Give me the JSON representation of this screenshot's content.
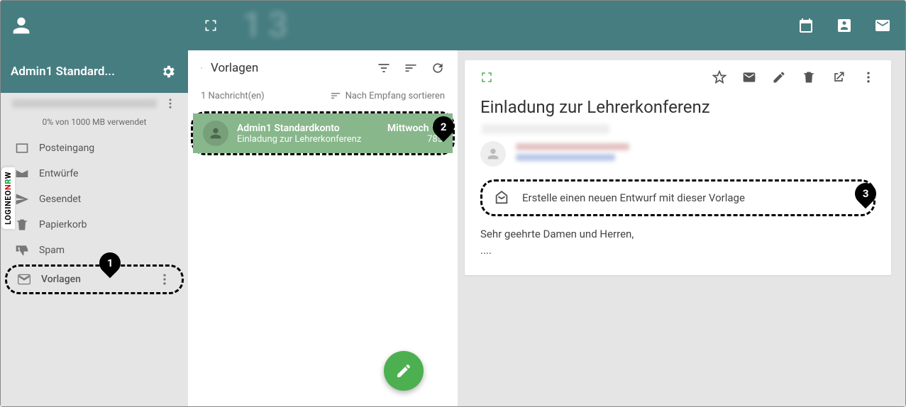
{
  "header": {
    "profile_name": "Admin1 Standard...",
    "big_blur": "13"
  },
  "sidebar": {
    "account_blur": "admin1@mail.logineo.de",
    "storage_line": "0% von 1000 MB verwendet",
    "folders": {
      "inbox": "Posteingang",
      "drafts": "Entwürfe",
      "sent": "Gesendet",
      "trash": "Papierkorb",
      "spam": "Spam",
      "templates": "Vorlagen"
    }
  },
  "mid": {
    "search_value": "Vorlagen",
    "count_line": "1 Nachricht(en)",
    "sort_label": "Nach Empfang sortieren",
    "message": {
      "from": "Admin1 Standardkonto",
      "date": "Mittwoch 13",
      "subject": "Einladung zur Lehrerkonferenz",
      "size": "785"
    }
  },
  "reading": {
    "title": "Einladung zur Lehrerkonferenz",
    "create_draft_label": "Erstelle einen neuen Entwurf mit dieser Vorlage",
    "body_line1": "Sehr geehrte Damen und Herren,",
    "body_line2": "...."
  },
  "annotations": {
    "pin1": "1",
    "pin2": "2",
    "pin3": "3"
  },
  "side_tab": {
    "base": "LOGINEO"
  }
}
